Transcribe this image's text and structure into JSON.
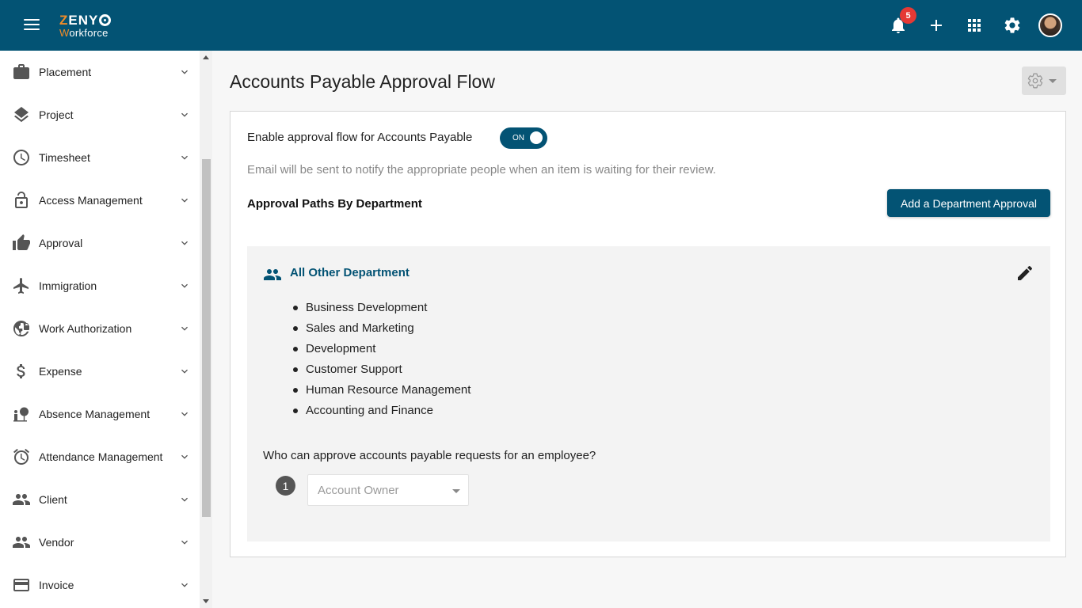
{
  "app": {
    "logo_top": "ZENY",
    "logo_bottom_first": "W",
    "logo_bottom_rest": "orkforce",
    "notification_count": "5"
  },
  "colors": {
    "brand": "#035374",
    "accent": "#f28c28",
    "badge": "#e53935"
  },
  "sidebar": {
    "items": [
      {
        "label": "Placement",
        "icon": "briefcase-icon"
      },
      {
        "label": "Project",
        "icon": "layers-icon"
      },
      {
        "label": "Timesheet",
        "icon": "clock-icon"
      },
      {
        "label": "Access Management",
        "icon": "lock-icon"
      },
      {
        "label": "Approval",
        "icon": "thumbs-up-icon"
      },
      {
        "label": "Immigration",
        "icon": "airplane-icon"
      },
      {
        "label": "Work Authorization",
        "icon": "globe-lock-icon"
      },
      {
        "label": "Expense",
        "icon": "dollar-icon"
      },
      {
        "label": "Absence Management",
        "icon": "person-beach-icon"
      },
      {
        "label": "Attendance Management",
        "icon": "alarm-icon"
      },
      {
        "label": "Client",
        "icon": "people-icon"
      },
      {
        "label": "Vendor",
        "icon": "people-icon"
      },
      {
        "label": "Invoice",
        "icon": "credit-card-icon"
      }
    ]
  },
  "main": {
    "title": "Accounts Payable Approval Flow",
    "enable_label": "Enable approval flow for Accounts Payable",
    "toggle_label": "ON",
    "email_note": "Email will be sent to notify the appropriate people when an item is waiting for their review.",
    "paths_title": "Approval Paths By Department",
    "add_button": "Add a Department Approval",
    "department": {
      "name": "All Other Department",
      "items": [
        "Business Development",
        "Sales and Marketing",
        "Development",
        "Customer Support",
        "Human Resource Management",
        "Accounting and Finance"
      ],
      "question": "Who can approve accounts payable requests for an employee?",
      "step_number": "1",
      "approver_placeholder": "Account Owner"
    }
  }
}
